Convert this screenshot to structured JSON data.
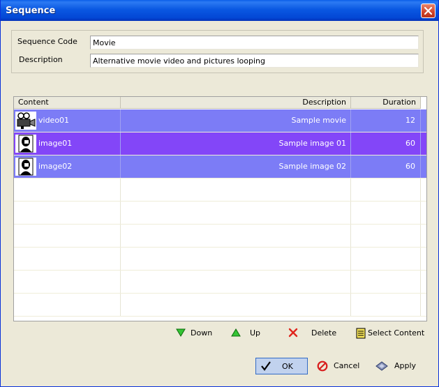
{
  "window": {
    "title": "Sequence"
  },
  "form": {
    "code_label": "Sequence Code",
    "code_value": "Movie",
    "desc_label": "Description",
    "desc_value": "Alternative movie video and pictures looping"
  },
  "grid": {
    "columns": [
      "Content",
      "Description",
      "Duration"
    ],
    "rows": [
      {
        "content": "video01",
        "description": "Sample movie",
        "duration": "12",
        "icon": "movie-camera-icon",
        "highlight": "#7c7cf6"
      },
      {
        "content": "image01",
        "description": "Sample image 01",
        "duration": "60",
        "icon": "portrait-icon",
        "highlight": "#8346f8"
      },
      {
        "content": "image02",
        "description": "Sample image 02",
        "duration": "60",
        "icon": "portrait-icon",
        "highlight": "#7c7cf6"
      }
    ]
  },
  "actions": {
    "down": "Down",
    "up": "Up",
    "delete": "Delete",
    "select_content": "Select Content"
  },
  "buttons": {
    "ok": "OK",
    "cancel": "Cancel",
    "apply": "Apply"
  }
}
